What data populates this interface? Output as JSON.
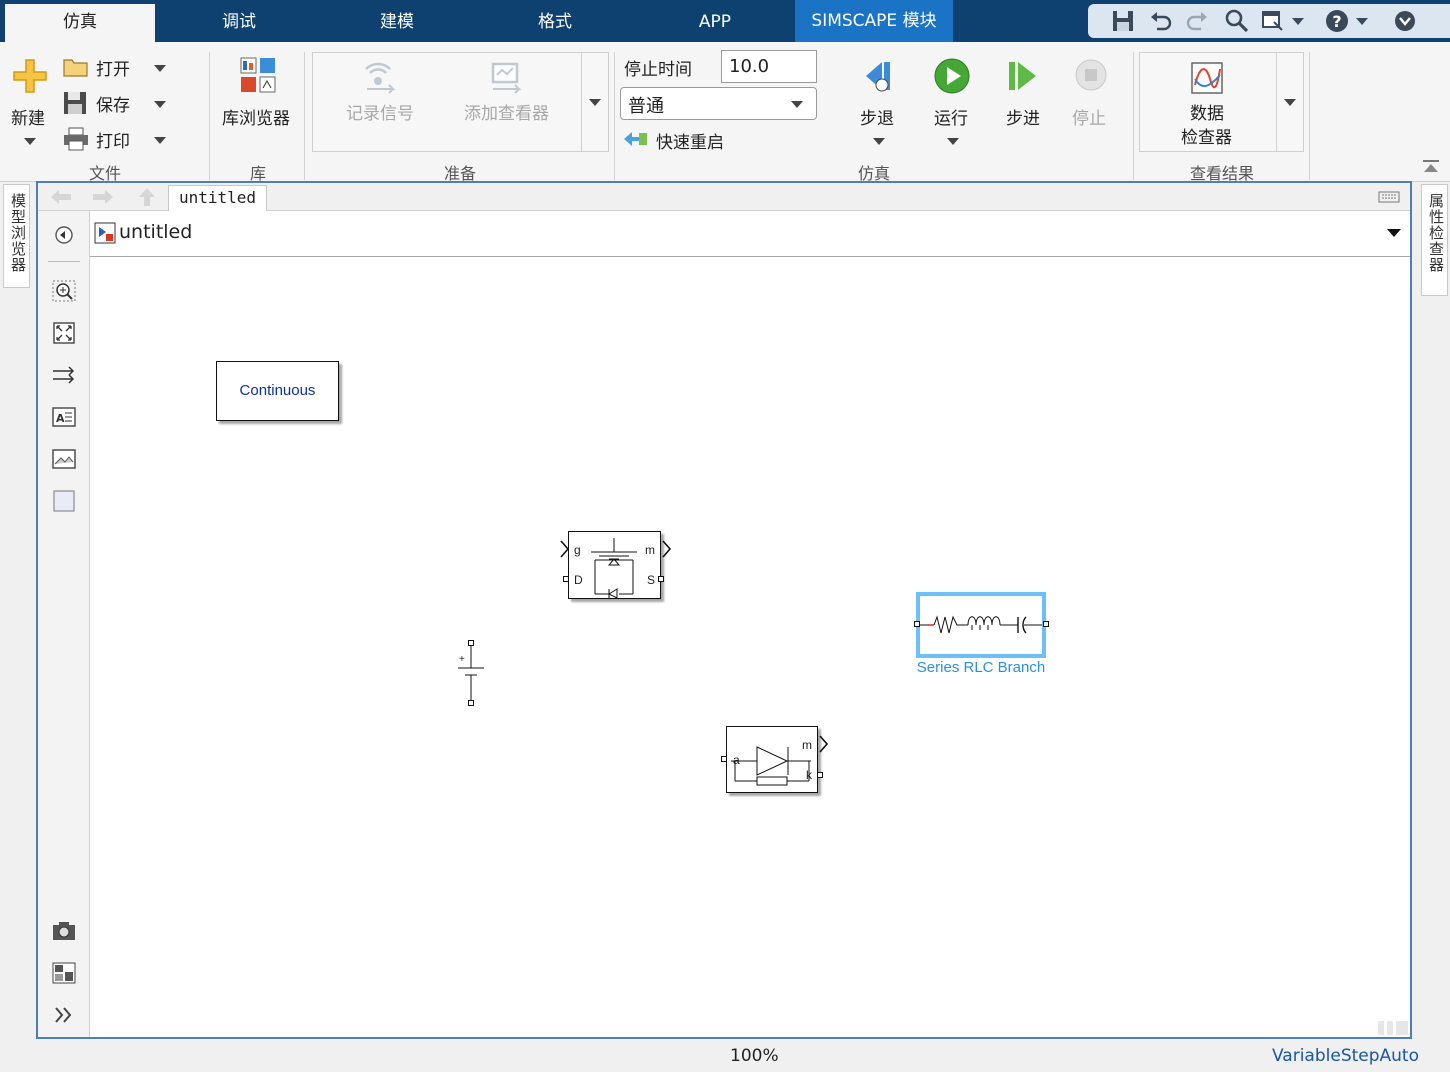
{
  "tabs": [
    "仿真",
    "调试",
    "建模",
    "格式",
    "APP",
    "SIMSCAPE 模块"
  ],
  "active_tab": "仿真",
  "ribbon": {
    "file": {
      "section_label": "文件",
      "new_label": "新建",
      "open_label": "打开",
      "save_label": "保存",
      "print_label": "打印"
    },
    "library": {
      "section_label": "库",
      "browser_label": "库浏览器"
    },
    "prepare": {
      "section_label": "准备",
      "log_signals_label": "记录信号",
      "add_viewer_label": "添加查看器"
    },
    "simulate": {
      "section_label": "仿真",
      "stop_time_label": "停止时间",
      "stop_time_value": "10.0",
      "mode_value": "普通",
      "fast_restart_label": "快速重启",
      "step_back_label": "步退",
      "run_label": "运行",
      "step_forward_label": "步进",
      "stop_label": "停止"
    },
    "review": {
      "section_label": "查看结果",
      "data_inspector_line1": "数据",
      "data_inspector_line2": "检查器"
    }
  },
  "left_pane_label": "模型浏览器",
  "right_pane_label": "属性检查器",
  "editor": {
    "doc_tab": "untitled",
    "address": "untitled"
  },
  "canvas": {
    "powergui_label": "Continuous",
    "mosfet_ports": {
      "g": "g",
      "m": "m",
      "d": "D",
      "s": "S"
    },
    "diode_ports": {
      "a": "a",
      "m": "m",
      "k": "k"
    },
    "rlc_label": "Series RLC Branch",
    "dc_plus": "+"
  },
  "status": {
    "zoom": "100%",
    "solver": "VariableStepAuto"
  },
  "colors": {
    "tabbar": "#0e4170",
    "simscape_tab": "#1a73c4",
    "selection": "#6cc0f5",
    "block_text_blue": "#0b2fa8",
    "solver_link": "#1756a9"
  }
}
